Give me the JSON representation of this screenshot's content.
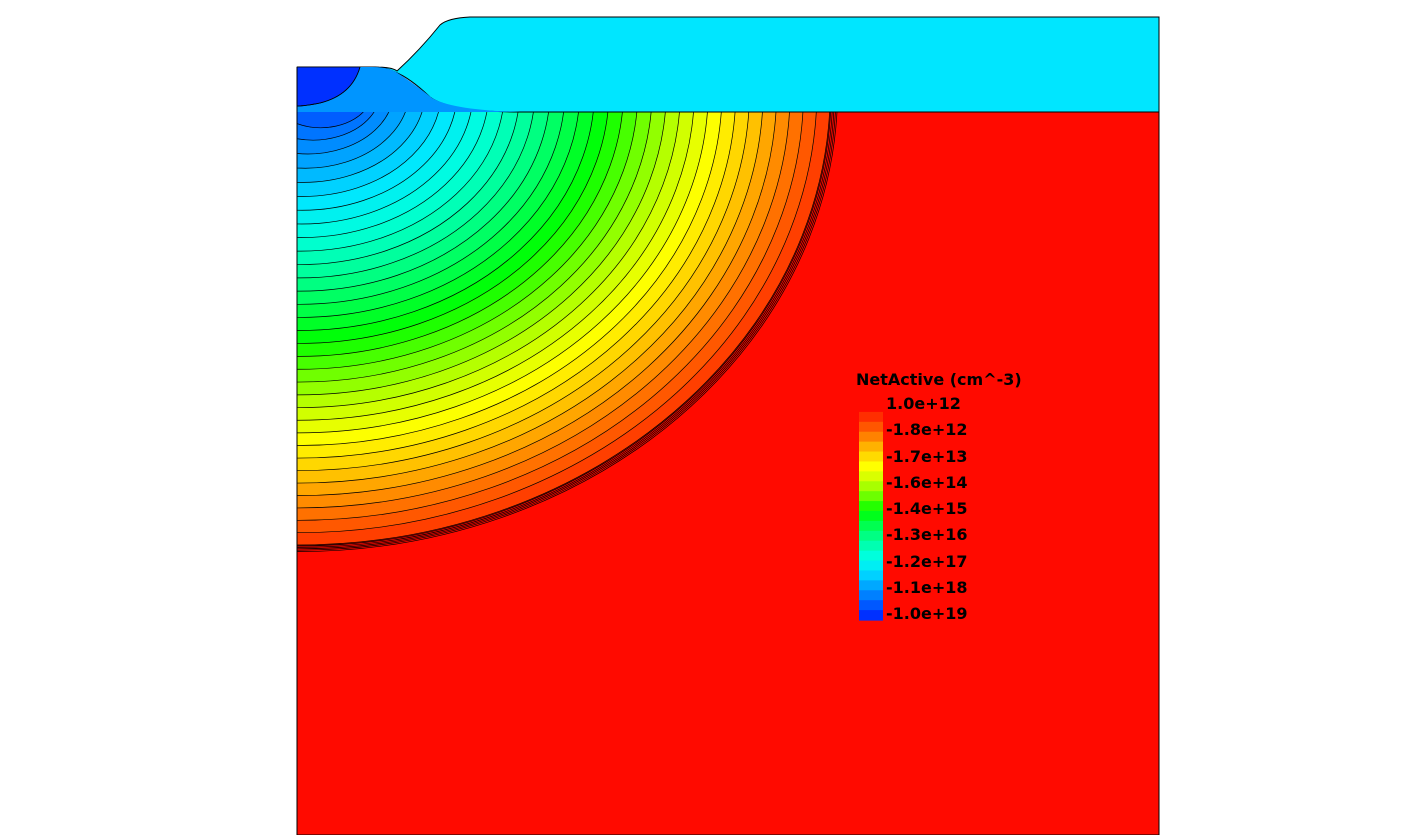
{
  "legend": {
    "title": "NetActive (cm^-3)",
    "labels": [
      "1.0e+12",
      "-1.8e+12",
      "-1.7e+13",
      "-1.6e+14",
      "-1.4e+15",
      "-1.3e+16",
      "-1.2e+17",
      "-1.1e+18",
      "-1.0e+19"
    ]
  },
  "colors": {
    "substrate": "#ff0a00",
    "oxide": "#00e6ff",
    "contour_line": "#000000",
    "background": "#ffffff"
  },
  "colormap": [
    "#0030ff",
    "#006cff",
    "#00a8ff",
    "#00e6ff",
    "#00ffdc",
    "#00ff9c",
    "#00ff50",
    "#00ff00",
    "#6cff00",
    "#c6ff00",
    "#ffff00",
    "#ffc800",
    "#ff8200",
    "#ff4000",
    "#ff0a00"
  ],
  "contour_levels": 34
}
